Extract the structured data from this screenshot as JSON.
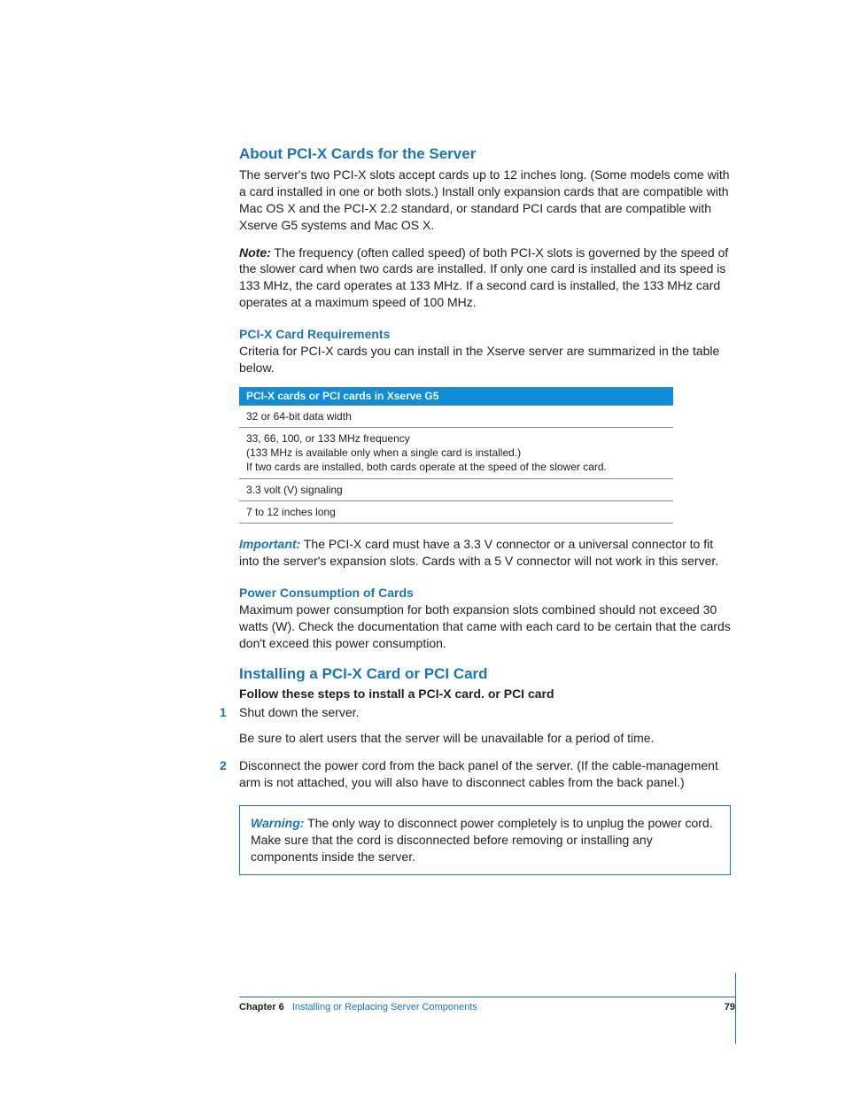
{
  "sections": {
    "about": {
      "heading": "About PCI-X Cards for the Server",
      "p1": "The server's two PCI-X slots accept cards up to 12 inches long. (Some models come with a card installed in one or both slots.) Install only expansion cards that are compatible with Mac OS X and the PCI-X 2.2 standard, or standard PCI cards that are compatible with Xserve G5 systems and Mac OS X.",
      "note_label": "Note:",
      "note_body": "The frequency (often called speed) of both PCI-X slots is governed by the speed of the slower card when two cards are installed. If only one card is installed and its speed is 133 MHz, the card operates at 133 MHz. If a second card is installed, the 133 MHz card operates at a maximum speed of 100 MHz."
    },
    "requirements": {
      "heading": "PCI-X Card Requirements",
      "intro": "Criteria for PCI-X cards you can install in the Xserve server are summarized in the table below.",
      "table_header": "PCI-X cards or PCI cards in Xserve G5",
      "row1": "32 or 64-bit data width",
      "row2_line1": "33, 66, 100, or 133 MHz frequency",
      "row2_line2": "(133 MHz is available only when a single card is installed.)",
      "row2_line3": "If two cards are installed, both cards operate at the speed of the slower card.",
      "row3": "3.3 volt (V) signaling",
      "row4": "7 to 12 inches long",
      "important_label": "Important:",
      "important_body": "The PCI-X card must have a 3.3 V connector or a universal connector to fit into the server's expansion slots. Cards with a 5 V connector will not work in this server."
    },
    "power": {
      "heading": "Power Consumption of Cards",
      "body": "Maximum power consumption for both expansion slots combined should not exceed 30 watts (W). Check the documentation that came with each card to be certain that the cards don't exceed this power consumption."
    },
    "install": {
      "heading": "Installing a PCI-X Card or PCI Card",
      "lead": "Follow these steps to install a PCI-X card. or PCI card",
      "step1_num": "1",
      "step1_a": "Shut down the server.",
      "step1_b": "Be sure to alert users that the server will be unavailable for a period of time.",
      "step2_num": "2",
      "step2": "Disconnect the power cord from the back panel of the server. (If the cable-management arm is not attached, you will also have to disconnect cables from the back panel.)",
      "warning_label": "Warning:",
      "warning_body": "The only way to disconnect power completely is to unplug the power cord. Make sure that the cord is disconnected before removing or installing any components inside the server."
    }
  },
  "footer": {
    "chapter": "Chapter 6",
    "title": "Installing or Replacing Server Components",
    "page": "79"
  }
}
